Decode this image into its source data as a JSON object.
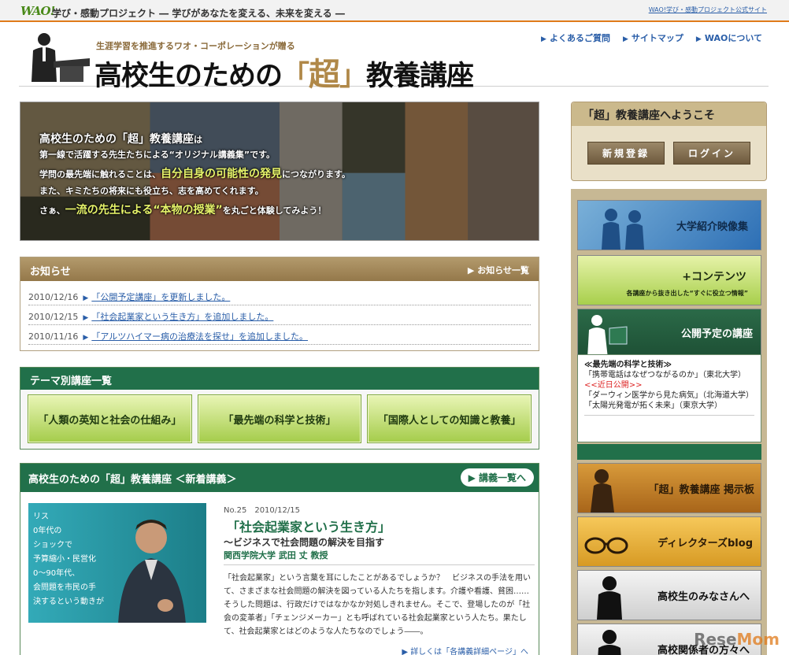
{
  "topbar": {
    "logo": "WAO!",
    "tagline": "学び・感動プロジェクト ― 学びがあなたを変える、未来を変える ―",
    "official_link": "WAO!学び・感動プロジェクト公式サイト"
  },
  "header": {
    "catchphrase": "生涯学習を推進するワオ・コーポレーションが贈る",
    "title_pre": "高校生のための",
    "title_open": "「",
    "title_chou": "超",
    "title_close": "」",
    "title_post": "教養講座",
    "nav": [
      {
        "label": "よくあるご質問"
      },
      {
        "label": "サイトマップ"
      },
      {
        "label": "WAOについて"
      }
    ]
  },
  "hero": {
    "line1": "高校生のための「超」教養講座",
    "line1_tail": "は",
    "line2": "第一線で活躍する先生たちによる“オリジナル講義集”です。",
    "line3_pre": "学問の最先端に触れることは、",
    "line3_hl": "自分自身の可能性の発見",
    "line3_post": "につながります。",
    "line4": "また、キミたちの将来にも役立ち、志を高めてくれます。",
    "line5_pre": "さぁ、",
    "line5_hl": "一流の先生による“本物の授業”",
    "line5_post": "を丸ごと体験してみよう！"
  },
  "news": {
    "title": "お知らせ",
    "more": "お知らせ一覧",
    "items": [
      {
        "date": "2010/12/16",
        "text": "「公開予定講座」を更新しました。"
      },
      {
        "date": "2010/12/15",
        "text": "「社会起業家という生き方」を追加しました。"
      },
      {
        "date": "2010/11/16",
        "text": "「アルツハイマー病の治療法を探せ」を追加しました。"
      }
    ]
  },
  "themes": {
    "title": "テーマ別講座一覧",
    "items": [
      {
        "label": "「人類の英知と社会の仕組み」"
      },
      {
        "label": "「最先端の科学と技術」"
      },
      {
        "label": "「国際人としての知識と教養」"
      }
    ]
  },
  "new_lectures": {
    "title": "高校生のための「超」教養講座 ＜新着講義＞",
    "list_button": "講義一覧へ",
    "video_lines": [
      "リス",
      "0年代の",
      "ショックで",
      "予算縮小・民営化",
      "0～90年代、",
      "会問題を市民の手",
      "決するという動きが"
    ],
    "number_date": "No.25　2010/12/15",
    "lecture_title": "「社会起業家という生き方」",
    "subtitle": "～ビジネスで社会問題の解決を目指す",
    "lecturer": "関西学院大学 武田 丈 教授",
    "body": "「社会起業家」という言葉を耳にしたことがあるでしょうか？　ビジネスの手法を用いて、さまざまな社会問題の解決を図っている人たちを指します。介護や看護、貧困……そうした問題は、行政だけではなかなか対処しきれません。そこで、登場したのが「社会の変革者」「チェンジメーカー」とも呼ばれている社会起業家という人たち。果たして、社会起業家とはどのような人たちなのでしょう――。",
    "more": "詳しくは「各講義詳細ページ」へ"
  },
  "sidebar": {
    "welcome_title": "「超」教養講座へようこそ",
    "register": "新規登録",
    "login": "ログイン",
    "banners": [
      {
        "label": "大学紹介映像集"
      },
      {
        "label": "+コンテンツ",
        "sub": "各講座から抜き出した“すぐに役立つ情報”"
      },
      {
        "label": "公開予定の講座"
      },
      {
        "label": "「超」教養講座 掲示板"
      },
      {
        "label": "ディレクターズblog"
      },
      {
        "label": "高校生のみなさんへ"
      },
      {
        "label": "高校関係者の方々へ"
      }
    ],
    "upcoming": {
      "title": "≪最先端の科学と技術≫",
      "item1": "「携帯電話はなぜつながるのか」（東北大学）",
      "item1_badge": "<<近日公開>>",
      "item2": "「ダーウィン医学から見た病気」（北海道大学）",
      "item3": "「太陽光発電が拓く未来」（東京大学）"
    }
  },
  "watermark": {
    "pre": "Rese",
    "post": "Mom"
  },
  "colors": {
    "accent": "#e07a1a",
    "green": "#21704a",
    "brown": "#94784a",
    "link": "#2a5ea8"
  }
}
